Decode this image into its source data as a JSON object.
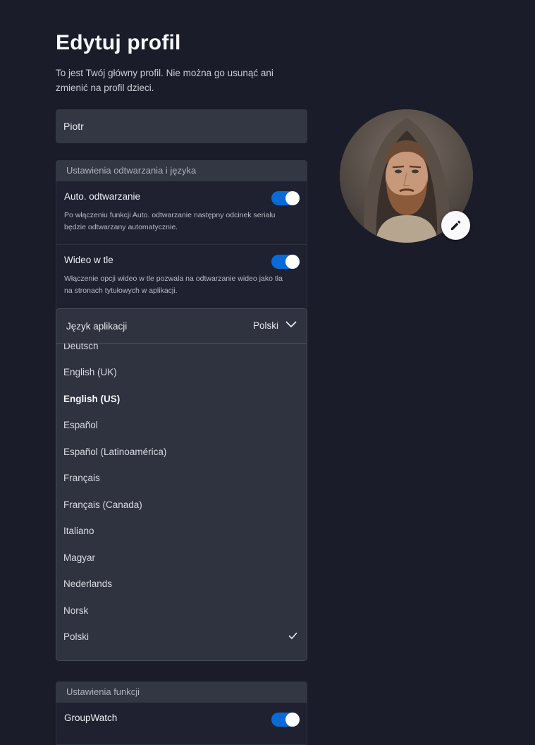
{
  "page": {
    "title": "Edytuj profil",
    "subtitle": "To jest Twój główny profil. Nie można go usunąć ani zmienić na profil dzieci."
  },
  "profile": {
    "name_value": "Piotr",
    "avatar_icon": "edit-pencil-icon"
  },
  "playback_section": {
    "header": "Ustawienia odtwarzania i języka",
    "autoplay": {
      "title": "Auto. odtwarzanie",
      "description": "Po włączeniu funkcji Auto. odtwarzanie następny odcinek serialu będzie odtwarzany automatycznie.",
      "enabled": true
    },
    "background_video": {
      "title": "Wideo w tle",
      "description": "Włączenie opcji wideo w tle pozwala na odtwarzanie wideo jako tła na stronach tytułowych w aplikacji.",
      "enabled": true
    }
  },
  "language_dropdown": {
    "label": "Język aplikacji",
    "selected": "Polski",
    "options": [
      {
        "label": "Deutsch"
      },
      {
        "label": "English (UK)"
      },
      {
        "label": "English (US)",
        "bold": true
      },
      {
        "label": "Español"
      },
      {
        "label": "Español (Latinoamérica)"
      },
      {
        "label": "Français"
      },
      {
        "label": "Français (Canada)"
      },
      {
        "label": "Italiano"
      },
      {
        "label": "Magyar"
      },
      {
        "label": "Nederlands"
      },
      {
        "label": "Norsk"
      },
      {
        "label": "Polski",
        "checked": true
      }
    ]
  },
  "features_section": {
    "header": "Ustawienia funkcji",
    "groupwatch": {
      "title": "GroupWatch",
      "enabled": true
    }
  },
  "colors": {
    "background": "#1a1c29",
    "toggle_on": "#0a6ad6",
    "panel": "#333643"
  }
}
